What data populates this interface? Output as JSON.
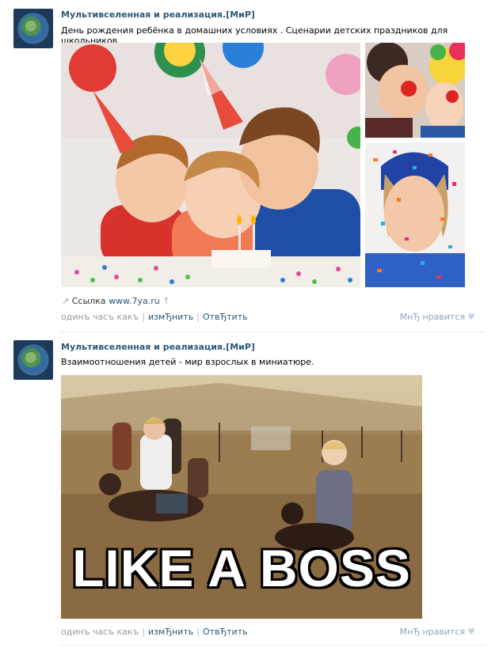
{
  "posts": [
    {
      "author": "Мультивселенная и реализация.[МиР]",
      "text": "День рождения ребёнка в домашних условиях . Сценарии детских праздников для школьников.",
      "link_label": "Ссылка",
      "link_url": "www.7ya.ru",
      "time": "одинъ часъ какъ",
      "edit": "измЂнить",
      "reply": "ОтвЂтить",
      "like": "МнЂ нравится"
    },
    {
      "author": "Мультивселенная и реализация.[МиР]",
      "text": "Взаимоотношения детей - мир взрослых в миниатюре.",
      "image_caption": "LIKE A BOSS",
      "time": "одинъ часъ какъ",
      "edit": "измЂнить",
      "reply": "ОтвЂтить",
      "like": "МнЂ нравится"
    }
  ]
}
